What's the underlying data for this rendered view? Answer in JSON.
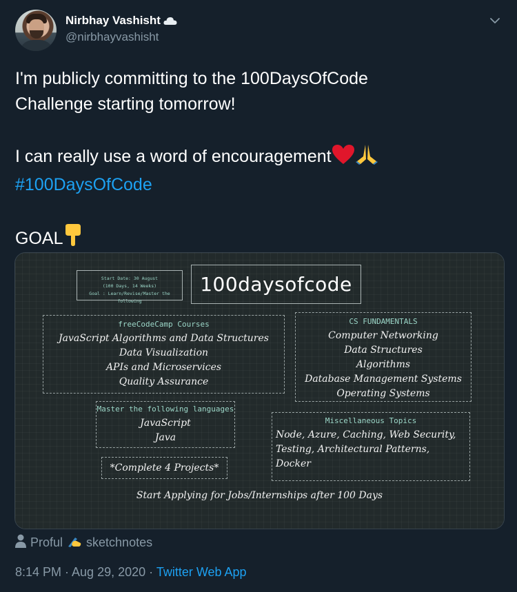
{
  "user": {
    "display_name": "Nirbhay Vashisht",
    "handle": "@nirbhayvashisht"
  },
  "tweet": {
    "line1": "I'm publicly committing to the 100DaysOfCode",
    "line2": "Challenge starting tomorrow!",
    "line3": "I can really use a word of encouragement",
    "hashtag": "#100DaysOfCode",
    "goal": "GOAL"
  },
  "image": {
    "start_box": [
      "Start Date: 30 August",
      "(100 Days, 14 Weeks)",
      "Goal : Learn/Revise/Master the following"
    ],
    "title": "100daysofcode",
    "fcc": {
      "heading": "freeCodeCamp Courses",
      "items": [
        "JavaScript Algorithms and Data Structures",
        "Data Visualization",
        "APIs and Microservices",
        "Quality Assurance"
      ]
    },
    "cs": {
      "heading": "CS FUNDAMENTALS",
      "items": [
        "Computer Networking",
        "Data Structures",
        "Algorithms",
        "Database Management Systems",
        "Operating Systems"
      ]
    },
    "languages": {
      "heading": "Master the following languages",
      "items": [
        "JavaScript",
        "Java"
      ]
    },
    "misc": {
      "heading": "Miscellaneous Topics",
      "items": [
        "Node, Azure, Caching, Web Security,",
        "Testing, Architectural Patterns,",
        "Docker"
      ]
    },
    "projects": "*Complete 4 Projects*",
    "footer": "Start Applying for Jobs/Internships after 100 Days"
  },
  "credit": {
    "person": "Proful",
    "tool": "sketchnotes"
  },
  "meta": {
    "time": "8:14 PM · Aug 29, 2020 · ",
    "app": "Twitter Web App"
  },
  "colors": {
    "background": "#15202b",
    "link": "#1da1f2",
    "secondary_text": "#8899a6"
  }
}
